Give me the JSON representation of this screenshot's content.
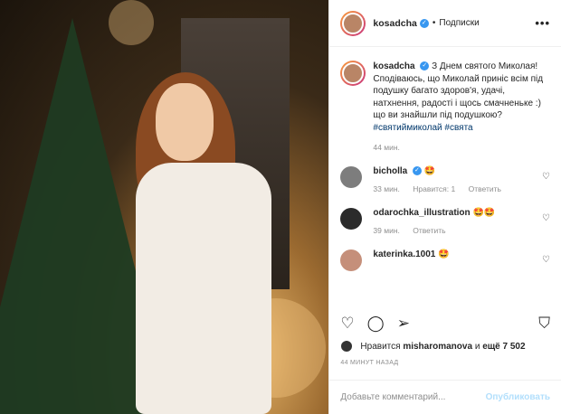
{
  "header": {
    "username": "kosadcha",
    "separator": "•",
    "follow_label": "Подписки",
    "more_icon": "more-dots-icon"
  },
  "caption": {
    "username": "kosadcha",
    "text": "З Днем святого Миколая! Сподіваюсь, що Миколай приніс всім під подушку багато здоров'я, удачі, натхнення, радості і щось смачненьке :) що ви знайшли під подушкою?",
    "hashtag1": "#святиймиколай",
    "hashtag2": "#свята",
    "time": "44 мин."
  },
  "comments": [
    {
      "username": "bicholla",
      "text": "🤩",
      "time": "33 мин.",
      "likes": "Нравится: 1",
      "reply": "Ответить",
      "avatar_color": "#7d7d7d"
    },
    {
      "username": "odarochka_illustration",
      "text": "🤩🤩",
      "time": "39 мин.",
      "reply": "Ответить",
      "avatar_color": "#2b2b2b"
    },
    {
      "username": "katerinka.1001",
      "text": "🤩",
      "avatar_color": "#c58f7a"
    }
  ],
  "actions": {
    "like_icon": "heart-icon",
    "comment_icon": "comment-icon",
    "share_icon": "share-icon",
    "save_icon": "bookmark-icon"
  },
  "likes": {
    "prefix": "Нравится",
    "user": "misharomanova",
    "and_more": "и",
    "count": "ещё 7 502"
  },
  "post_age": "44 МИНУТ НАЗАД",
  "add_comment": {
    "placeholder": "Добавьте комментарий...",
    "publish": "Опубликовать"
  },
  "colors": {
    "link": "#00376b",
    "verified": "#3897f0",
    "publish_disabled": "#b2dffc"
  }
}
